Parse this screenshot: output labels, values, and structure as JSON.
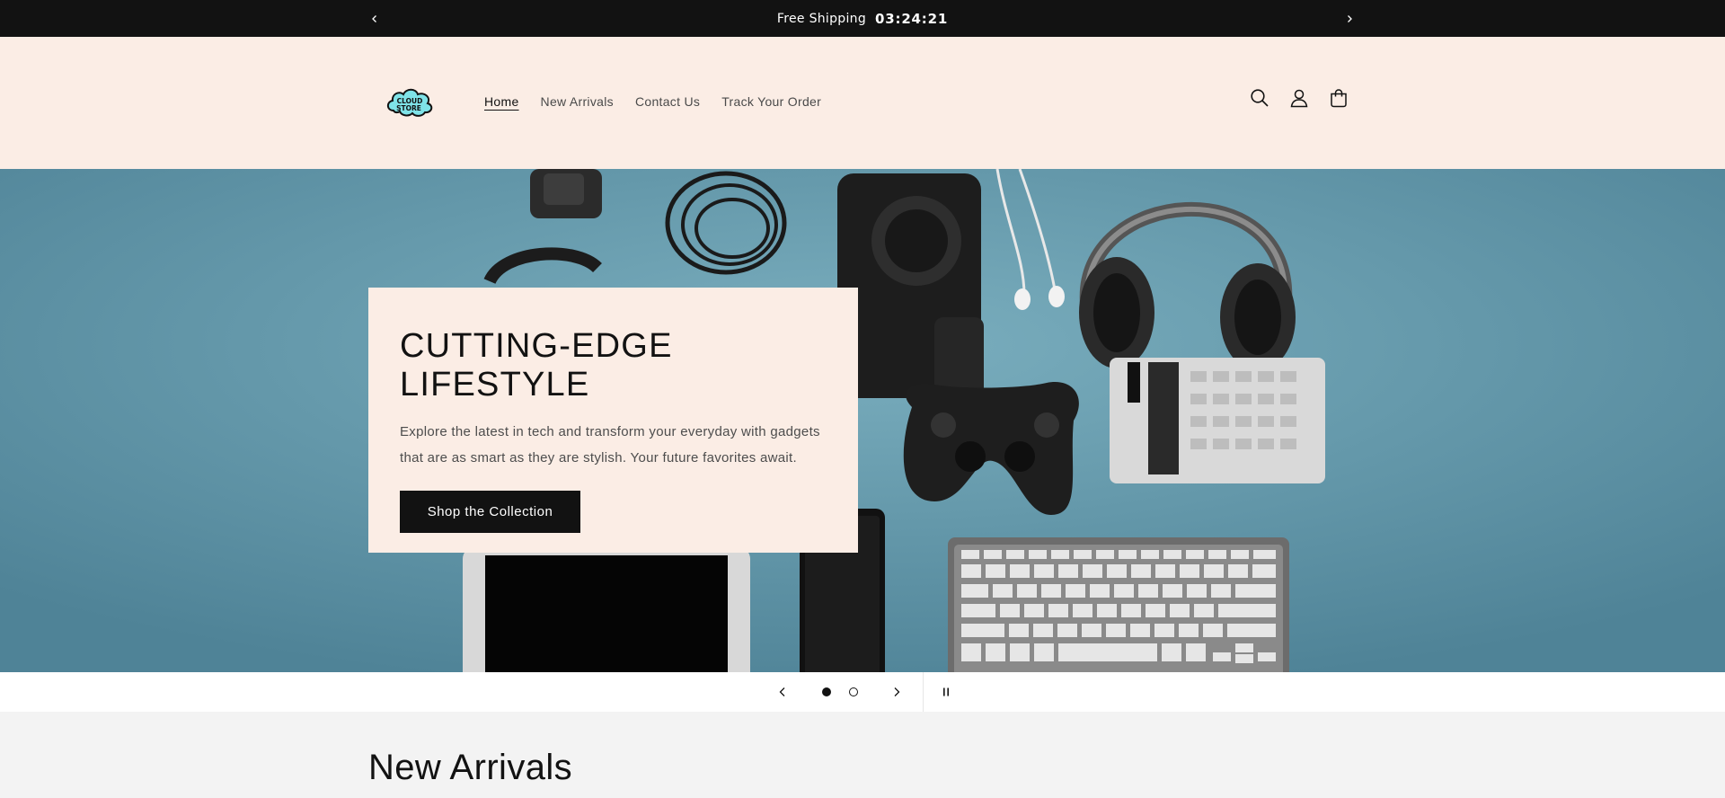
{
  "announcement": {
    "text": "Free Shipping",
    "timer": "03:24:21"
  },
  "header": {
    "logo_text_line1": "CLOUD",
    "logo_text_line2": "STORE",
    "nav": [
      {
        "label": "Home",
        "active": true
      },
      {
        "label": "New Arrivals",
        "active": false
      },
      {
        "label": "Contact Us",
        "active": false
      },
      {
        "label": "Track Your Order",
        "active": false
      }
    ],
    "icons": [
      "search-icon",
      "account-icon",
      "cart-icon"
    ]
  },
  "hero": {
    "title": "CUTTING-EDGE LIFESTYLE",
    "description": "Explore the latest in tech and transform your everyday with gadgets that are as smart as they are stylish. Your future favorites await.",
    "button_label": "Shop the Collection"
  },
  "slider": {
    "slide_count": 2,
    "current_slide": 1
  },
  "section": {
    "title": "New Arrivals"
  },
  "colors": {
    "announcement_bg": "#121212",
    "header_bg": "#fbede5",
    "hero_bg": "#5e93a6",
    "logo_cloud": "#7fe3e8"
  }
}
